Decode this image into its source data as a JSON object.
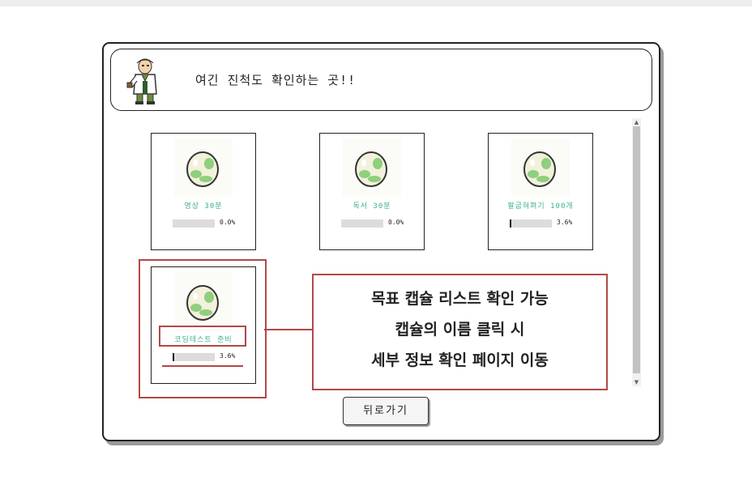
{
  "header": {
    "title": "여긴 진척도 확인하는 곳!!"
  },
  "capsules": [
    {
      "name": "명상 30분",
      "progress_label": "0.0%",
      "progress": 0.0
    },
    {
      "name": "독서 30분",
      "progress_label": "0.0%",
      "progress": 0.0
    },
    {
      "name": "팔굽혀펴기 100개",
      "progress_label": "3.6%",
      "progress": 3.6
    },
    {
      "name": "코딩테스트 준비",
      "progress_label": "3.6%",
      "progress": 3.6
    }
  ],
  "back_button": "뒤로가기",
  "annotation": {
    "lines": [
      "목표 캡슐 리스트 확인 가능",
      "캡슐의 이름 클릭 시",
      "세부 정보 확인 페이지 이동"
    ],
    "color": "#b24848"
  },
  "colors": {
    "capsule_name": "#3fb28a",
    "egg_spots": "#8fcf7e",
    "egg_shell": "#f2f1dc"
  },
  "icons": [
    "professor-avatar-icon",
    "egg-icon",
    "scroll-up-icon",
    "scroll-down-icon"
  ]
}
